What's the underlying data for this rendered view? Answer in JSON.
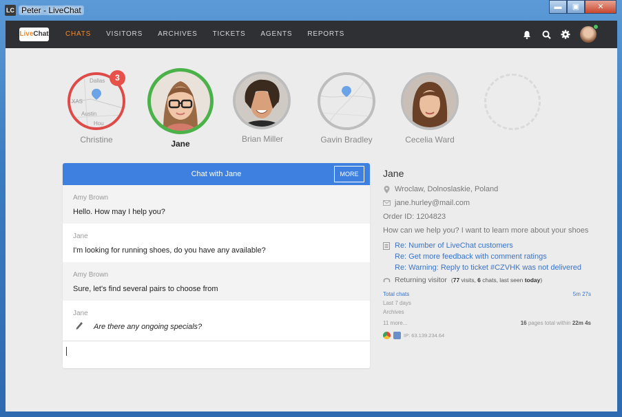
{
  "window": {
    "logo_text": "LC",
    "title": "Peter - LiveChat",
    "minimize": "▬",
    "maximize": "▣",
    "close": "✕"
  },
  "nav": {
    "brand_live": "Live",
    "brand_chat": "Chat",
    "items": [
      "CHATS",
      "VISITORS",
      "ARCHIVES",
      "TICKETS",
      "AGENTS",
      "REPORTS"
    ],
    "active_index": 0,
    "icons": [
      "bell-icon",
      "search-icon",
      "gear-icon"
    ]
  },
  "queue": [
    {
      "name": "Christine",
      "badge": "3",
      "ring": "#dd4a47",
      "kind": "map"
    },
    {
      "name": "Jane",
      "ring": "#4bb24a",
      "kind": "photo",
      "bold": true
    },
    {
      "name": "Brian Miller",
      "ring": "#bdbdbd",
      "kind": "photo"
    },
    {
      "name": "Gavin Bradley",
      "ring": "#bdbdbd",
      "kind": "map"
    },
    {
      "name": "Cecelia Ward",
      "ring": "#bdbdbd",
      "kind": "photo"
    }
  ],
  "map_labels": {
    "dallas": "Dallas",
    "xas": "XAS",
    "austin": "Austin",
    "hou": "Hou"
  },
  "chat": {
    "title": "Chat with Jane",
    "more_label": "MORE",
    "messages": [
      {
        "author": "Amy Brown",
        "text": "Hello. How may I help you?"
      },
      {
        "author": "Jane",
        "text": "I'm looking for running shoes, do you have any available?"
      },
      {
        "author": "Amy Brown",
        "text": "Sure, let's find several pairs to choose from"
      },
      {
        "author": "Jane",
        "text": "Are there any ongoing specials?"
      }
    ]
  },
  "visitor": {
    "name": "Jane",
    "location": "Wroclaw, Dolnoslaskie, Poland",
    "email": "jane.hurley@mail.com",
    "order": "Order ID: 1204823",
    "question": "How can we help you? I want to learn more about your shoes",
    "tickets": [
      "Re: Number of LiveChat customers",
      "Re: Get more feedback with comment ratings",
      "Re: Warning: Reply to ticket #CZVHK was not delivered"
    ],
    "returning_label": "Returning visitor",
    "returning_open": "(",
    "visits_count": "77",
    "visits_word": " visits, ",
    "chats_count": "6",
    "chats_word": " chats, last seen ",
    "last_seen": "today",
    "returning_close": ")",
    "total_chats_label": "Total chats",
    "total_chats_value": "5m 27s",
    "last7_label": "Last 7 days",
    "archives_label": "Archives",
    "more_label": "11 more...",
    "pages_count": "16",
    "pages_text": " pages total within ",
    "pages_time": "22m 4s",
    "ip": "IP: 63.139.234.64"
  }
}
